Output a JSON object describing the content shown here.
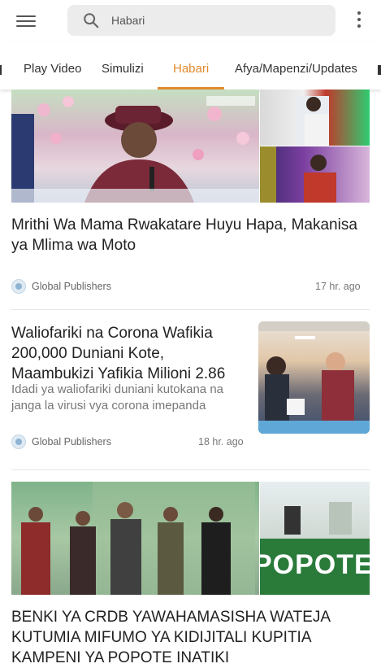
{
  "search": {
    "value": "Habari"
  },
  "tabs": [
    "Play Video",
    "Simulizi",
    "Habari",
    "Afya/Mapenzi/Updates"
  ],
  "active_tab": "Habari",
  "articles": [
    {
      "headline": "Mrithi Wa Mama Rwakatare Huyu Hapa, Makanisa ya Mlima wa Moto",
      "source": "Global Publishers",
      "time": "17 hr. ago"
    },
    {
      "headline": "Waliofariki na Corona Wafikia 200,000 Duniani Kote, Maambukizi Yafikia Milioni 2.86",
      "summary": "Idadi ya waliofariki duniani kutokana na janga la virusi vya corona imepanda",
      "source": "Global Publishers",
      "time": "18 hr. ago"
    },
    {
      "headline": "BENKI YA CRDB YAWAHAMASISHA WATEJA KUTUMIA MIFUMO YA KIDIJITALI KUPITIA KAMPENI YA POPOTE INATIKI",
      "image_banner_text": "POPOTE INATIKI"
    }
  ],
  "colors": {
    "accent": "#e08a2c",
    "search_bg": "#ececec"
  }
}
